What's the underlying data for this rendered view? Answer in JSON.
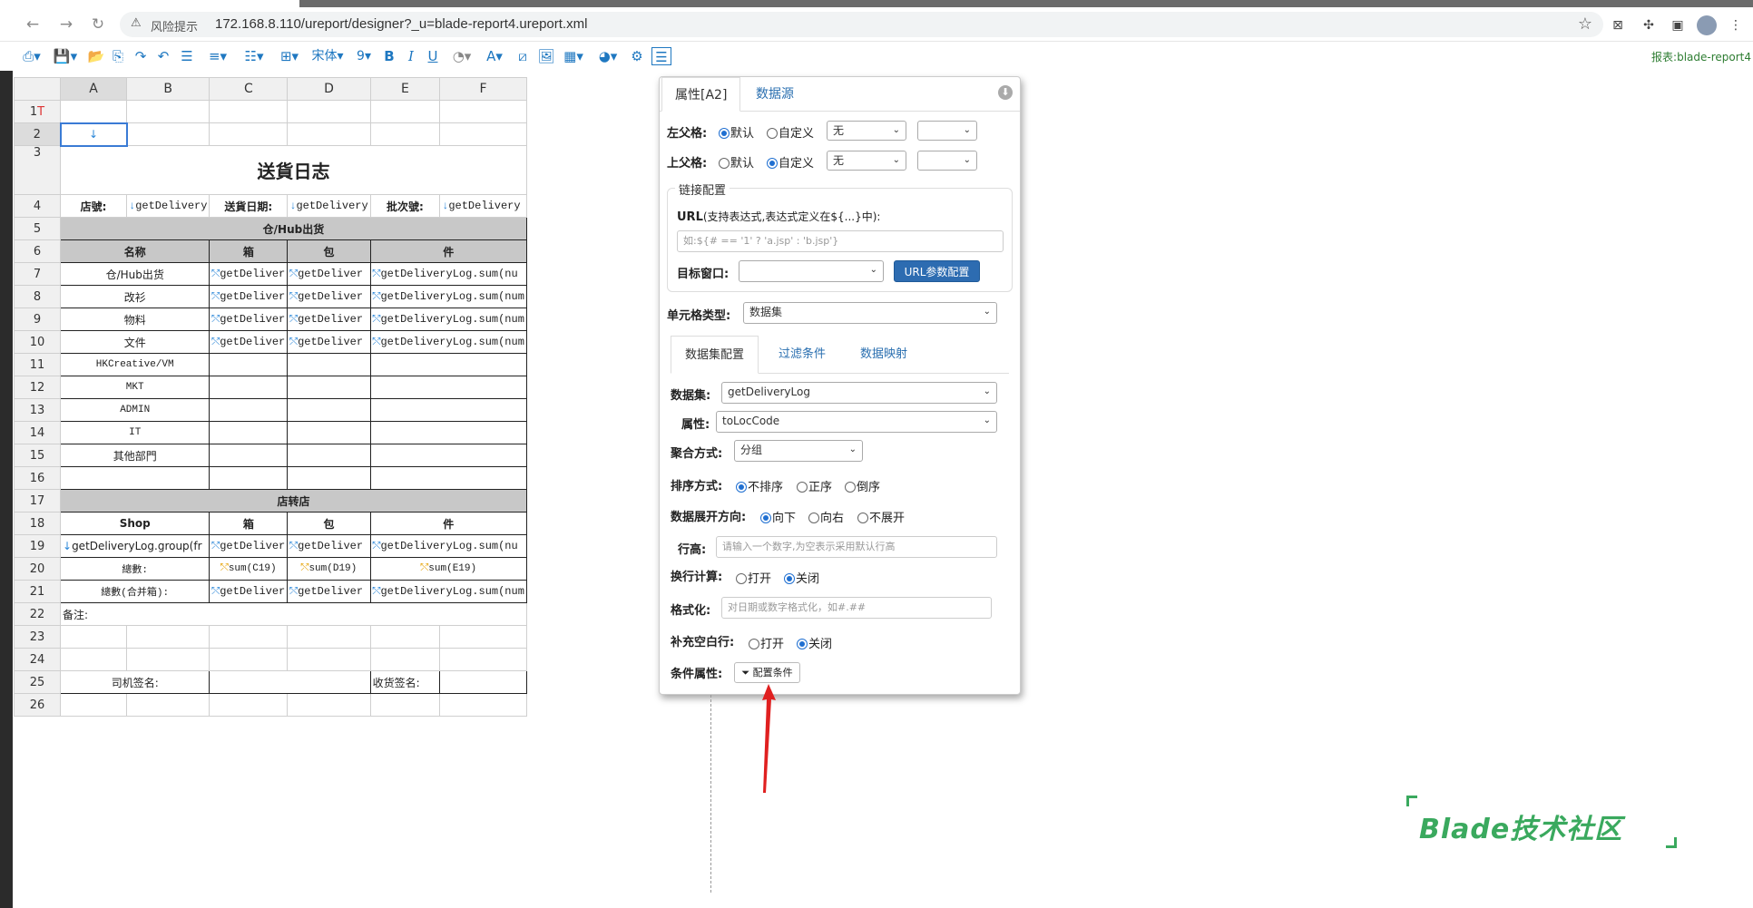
{
  "browser": {
    "security_label": "风险提示",
    "url": "172.168.8.110/ureport/designer?_u=blade-report4.ureport.xml"
  },
  "toolbar": {
    "font_name": "宋体",
    "font_size": "9",
    "report_label": "报表:blade-report4"
  },
  "sheet": {
    "columns": [
      "A",
      "B",
      "C",
      "D",
      "E",
      "F"
    ],
    "row_numbers": [
      "1",
      "2",
      "3",
      "4",
      "5",
      "6",
      "7",
      "8",
      "9",
      "10",
      "11",
      "12",
      "13",
      "14",
      "15",
      "16",
      "17",
      "18",
      "19",
      "20",
      "21",
      "22",
      "23",
      "24",
      "25",
      "26"
    ],
    "row1_marker": "T",
    "title": "送貨日志",
    "row4": {
      "shop_label": "店號:",
      "shop_value": "getDelivery",
      "date_label": "送貨日期:",
      "date_value": "getDelivery",
      "batch_label": "批次號:",
      "batch_value": "getDelivery"
    },
    "section1_title": "仓/Hub出货",
    "section1_headers": [
      "名称",
      "箱",
      "包",
      "件"
    ],
    "section1_rows": [
      {
        "name": "仓/Hub出货",
        "c": "getDeliver",
        "d": "getDeliver",
        "e": "getDeliveryLog.sum(nu"
      },
      {
        "name": "改衫",
        "c": "getDeliver",
        "d": "getDeliver",
        "e": "getDeliveryLog.sum(num"
      },
      {
        "name": "物料",
        "c": "getDeliver",
        "d": "getDeliver",
        "e": "getDeliveryLog.sum(num"
      },
      {
        "name": "文件",
        "c": "getDeliver",
        "d": "getDeliver",
        "e": "getDeliveryLog.sum(num"
      },
      {
        "name": "HKCreative/VM",
        "c": "",
        "d": "",
        "e": ""
      },
      {
        "name": "MKT",
        "c": "",
        "d": "",
        "e": ""
      },
      {
        "name": "ADMIN",
        "c": "",
        "d": "",
        "e": ""
      },
      {
        "name": "IT",
        "c": "",
        "d": "",
        "e": ""
      },
      {
        "name": "其他部門",
        "c": "",
        "d": "",
        "e": ""
      }
    ],
    "section2_title": "店转店",
    "section2_headers": [
      "Shop",
      "箱",
      "包",
      "件"
    ],
    "row19": {
      "a": "getDeliveryLog.group(fr",
      "c": "getDeliver",
      "d": "getDeliver",
      "e": "getDeliveryLog.sum(nu"
    },
    "row20": {
      "a": "總數:",
      "c": "sum(C19)",
      "d": "sum(D19)",
      "e": "sum(E19)"
    },
    "row21": {
      "a": "總數(合并箱):",
      "c": "getDeliver",
      "d": "getDeliver",
      "e": "getDeliveryLog.sum(num"
    },
    "remark_label": "备注:",
    "driver_sign": "司机签名:",
    "receiver_sign": "收货签名:"
  },
  "panel": {
    "tab_properties": "属性[A2]",
    "tab_datasource": "数据源",
    "left_parent_label": "左父格:",
    "top_parent_label": "上父格:",
    "opt_default": "默认",
    "opt_custom": "自定义",
    "parent_select_value": "无",
    "link_config_legend": "链接配置",
    "url_label_bold": "URL",
    "url_label_hint": "(支持表达式,表达式定义在${...}中):",
    "url_placeholder": "如:${# == '1' ? 'a.jsp' : 'b.jsp'}",
    "target_window_label": "目标窗口:",
    "url_param_button": "URL参数配置",
    "cell_type_label": "单元格类型:",
    "cell_type_value": "数据集",
    "subtab_dataset_config": "数据集配置",
    "subtab_filter": "过滤条件",
    "subtab_mapping": "数据映射",
    "dataset_label": "数据集:",
    "dataset_value": "getDeliveryLog",
    "property_label": "属性:",
    "property_value": "toLocCode",
    "aggregate_label": "聚合方式:",
    "aggregate_value": "分组",
    "sort_label": "排序方式:",
    "sort_none": "不排序",
    "sort_asc": "正序",
    "sort_desc": "倒序",
    "expand_label": "数据展开方向:",
    "expand_down": "向下",
    "expand_right": "向右",
    "expand_none": "不展开",
    "row_height_label": "行高:",
    "row_height_placeholder": "请输入一个数字,为空表示采用默认行高",
    "wrap_label": "换行计算:",
    "opt_on": "打开",
    "opt_off": "关闭",
    "format_label": "格式化:",
    "format_placeholder": "对日期或数字格式化，如#.##",
    "fill_blank_label": "补充空白行:",
    "condition_label": "条件属性:",
    "condition_button": "配置条件"
  },
  "watermark": {
    "text": "Blade技术社区"
  },
  "colors": {
    "accent_blue": "#1f78c1",
    "button_primary": "#2d6cb1",
    "arrow_red": "#e02020",
    "watermark_green": "#3aa95e"
  }
}
